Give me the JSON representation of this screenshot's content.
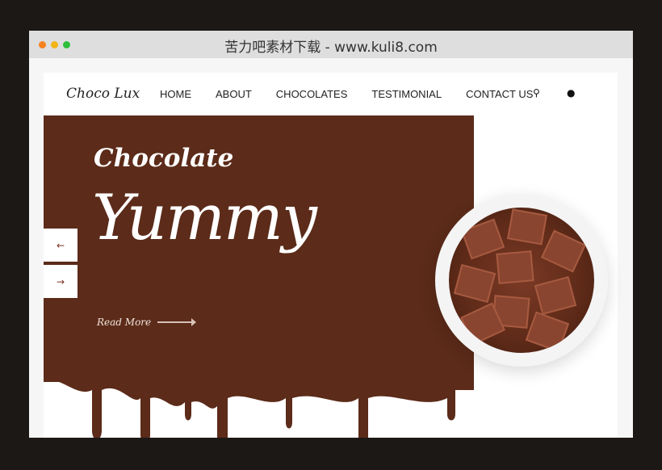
{
  "window": {
    "title": "苦力吧素材下载 - www.kuli8.com",
    "dots": [
      "#f5811f",
      "#f2b517",
      "#2dbe3c"
    ]
  },
  "nav": {
    "logo": "Choco Lux",
    "items": [
      "HOME",
      "ABOUT",
      "CHOCOLATES",
      "TESTIMONIAL",
      "CONTACT US"
    ],
    "icons": [
      "search-icon",
      "user-icon"
    ]
  },
  "hero": {
    "subtitle": "Chocolate",
    "title": "Yummy",
    "read_more": "Read More",
    "prev": "←",
    "next": "→",
    "brand_color": "#5c2b19"
  }
}
